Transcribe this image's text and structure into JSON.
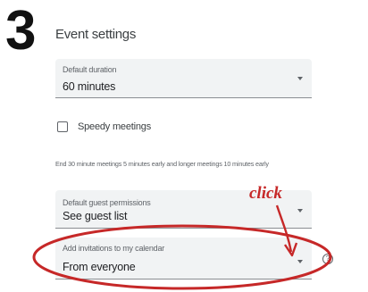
{
  "step": {
    "number": "3"
  },
  "section": {
    "title": "Event settings"
  },
  "fields": {
    "default_duration": {
      "label": "Default duration",
      "value": "60 minutes"
    },
    "speedy_meetings": {
      "label": "Speedy meetings",
      "checked": false
    },
    "speedy_help": "End 30 minute meetings 5 minutes early and longer meetings 10 minutes early",
    "guest_permissions": {
      "label": "Default guest permissions",
      "value": "See guest list"
    },
    "add_invitations": {
      "label": "Add invitations to my calendar",
      "value": "From everyone"
    }
  },
  "annotation": {
    "text": "click",
    "color": "#c62828"
  },
  "icons": {
    "help": "help-circle-icon",
    "dropdown": "chevron-down-icon"
  },
  "colors": {
    "field_bg": "#f1f3f4",
    "text": "#3c4043"
  }
}
